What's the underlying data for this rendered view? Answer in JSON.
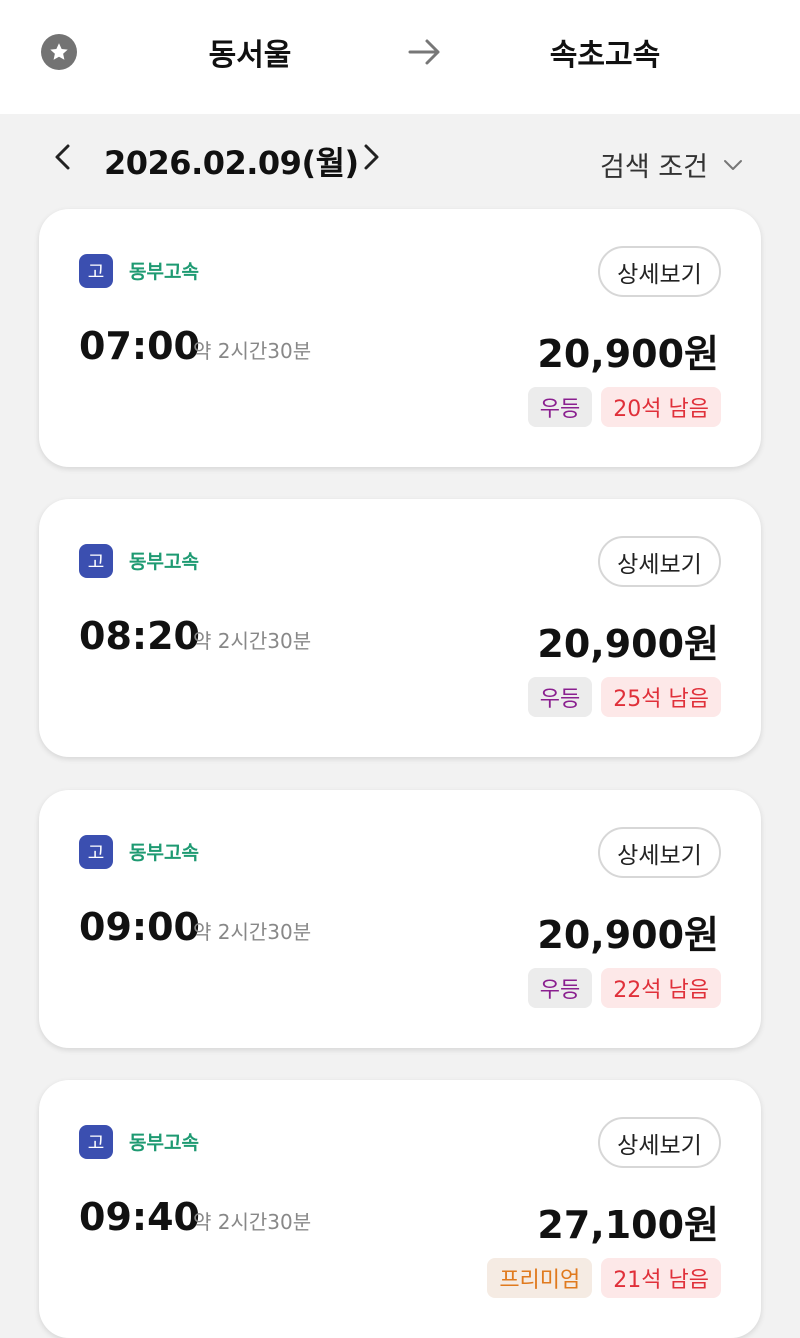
{
  "header": {
    "favorite_icon": "star-icon",
    "from": "동서울",
    "arrow_icon": "arrow-right-icon",
    "to": "속초고속"
  },
  "date_bar": {
    "prev_icon": "chevron-left-icon",
    "date": "2026.02.09(월)",
    "next_icon": "chevron-right-icon",
    "filter_label": "검색 조건",
    "filter_icon": "chevron-down-icon"
  },
  "colors": {
    "company_badge": "#3b4fb0",
    "company_name": "#1e9a72",
    "class_standard": "#8a1f8f",
    "class_premium": "#e07a1e",
    "seats": "#e0303a"
  },
  "buses": [
    {
      "company_badge": "고",
      "company": "동부고속",
      "detail_label": "상세보기",
      "time": "07:00",
      "duration": "약 2시간30분",
      "price": "20,900원",
      "class": "우등",
      "seats": "20석 남음"
    },
    {
      "company_badge": "고",
      "company": "동부고속",
      "detail_label": "상세보기",
      "time": "08:20",
      "duration": "약 2시간30분",
      "price": "20,900원",
      "class": "우등",
      "seats": "25석 남음"
    },
    {
      "company_badge": "고",
      "company": "동부고속",
      "detail_label": "상세보기",
      "time": "09:00",
      "duration": "약 2시간30분",
      "price": "20,900원",
      "class": "우등",
      "seats": "22석 남음"
    },
    {
      "company_badge": "고",
      "company": "동부고속",
      "detail_label": "상세보기",
      "time": "09:40",
      "duration": "약 2시간30분",
      "price": "27,100원",
      "class": "프리미엄",
      "seats": "21석 남음"
    }
  ]
}
